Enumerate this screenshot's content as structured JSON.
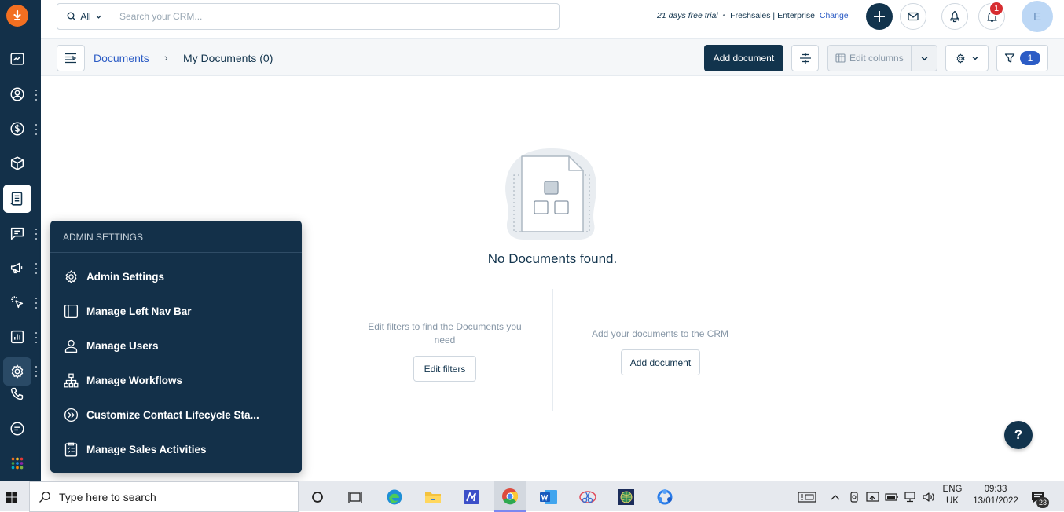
{
  "topbar": {
    "search_scope": "All",
    "search_placeholder": "Search your CRM...",
    "trial_days": "21 days free trial",
    "trial_separator": "•",
    "plan": "Freshsales | Enterprise",
    "change_link": "Change",
    "notification_count": "1",
    "avatar_initial": "E"
  },
  "subbar": {
    "breadcrumb_root": "Documents",
    "breadcrumb_sep": "›",
    "breadcrumb_current": "My Documents (0)",
    "add_document": "Add document",
    "edit_columns": "Edit columns",
    "filter_count": "1"
  },
  "empty_state": {
    "title": "No Documents found.",
    "left_text": "Edit filters to find the Documents you need",
    "left_button": "Edit filters",
    "right_text": "Add your documents to the CRM",
    "right_button": "Add document"
  },
  "help_button": "?",
  "admin_menu": {
    "header": "ADMIN SETTINGS",
    "items": [
      {
        "label": "Admin Settings",
        "icon": "gear-icon"
      },
      {
        "label": "Manage Left Nav Bar",
        "icon": "sidebar-layout-icon"
      },
      {
        "label": "Manage Users",
        "icon": "user-icon"
      },
      {
        "label": "Manage Workflows",
        "icon": "workflow-icon"
      },
      {
        "label": "Customize Contact Lifecycle Sta...",
        "icon": "lifecycle-icon"
      },
      {
        "label": "Manage Sales Activities",
        "icon": "checklist-icon"
      }
    ]
  },
  "taskbar": {
    "search_placeholder": "Type here to search",
    "language": "ENG",
    "region": "UK",
    "time": "09:33",
    "date": "13/01/2022",
    "notification_count": "23"
  },
  "colors": {
    "nav_bg": "#133049",
    "primary": "#12344d",
    "link": "#2c5cc5",
    "brand": "#f26f21",
    "alert": "#d72d30"
  }
}
